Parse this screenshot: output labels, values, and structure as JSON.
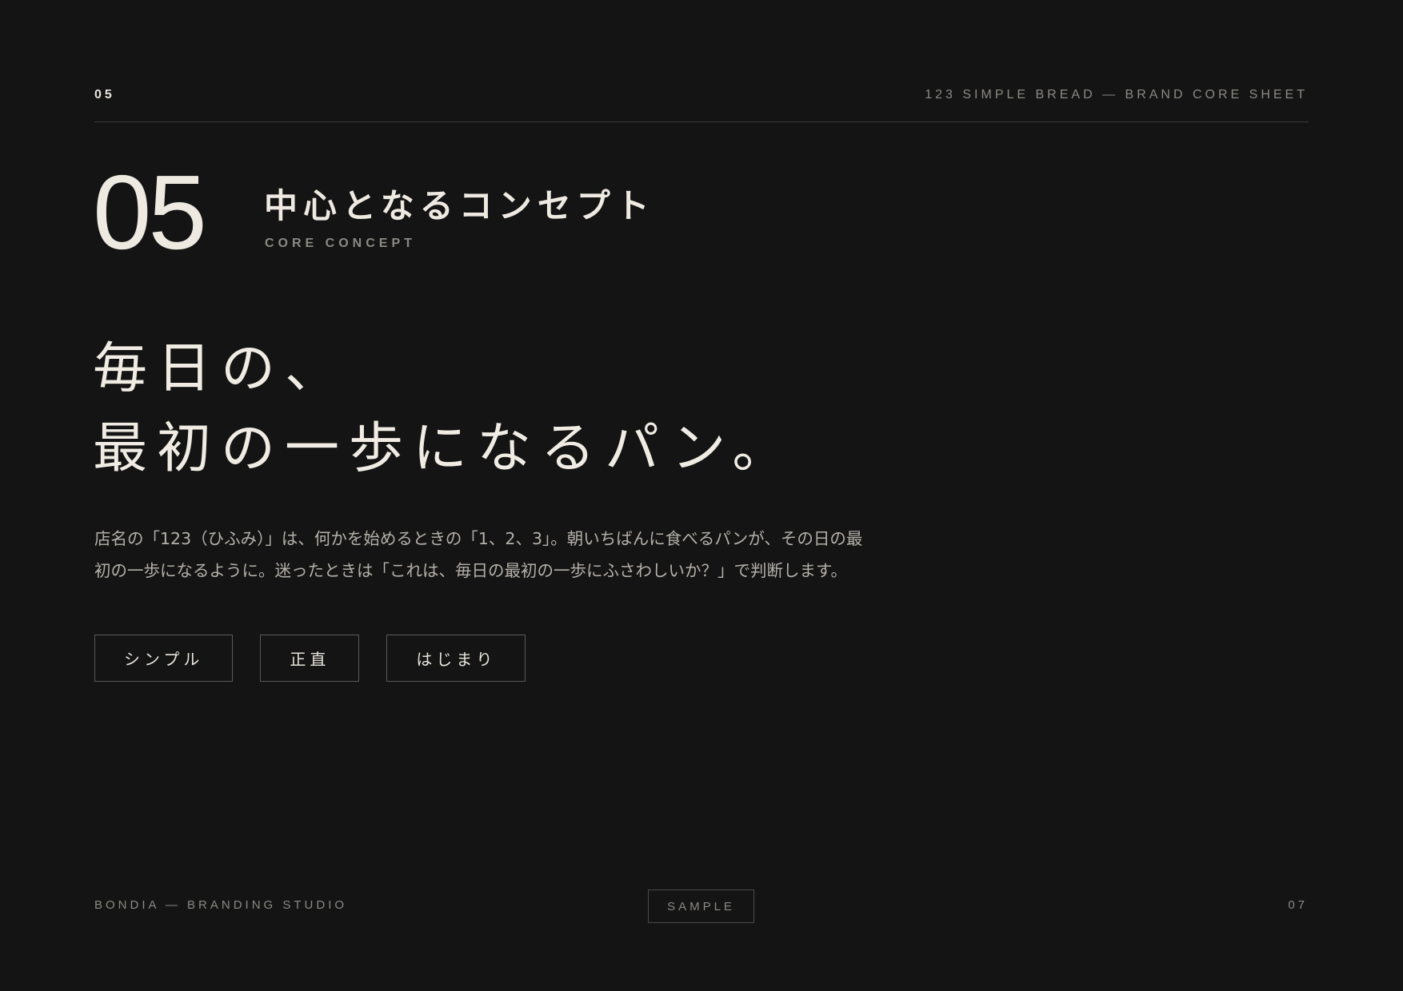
{
  "header": {
    "page_number": "05",
    "document_title": "123 SIMPLE BREAD — BRAND CORE SHEET"
  },
  "section": {
    "number": "05",
    "title": "中心となるコンセプト",
    "subtitle": "CORE CONCEPT"
  },
  "headline": {
    "lines": [
      "毎日の、",
      "最初の一歩になるパン。"
    ]
  },
  "body": {
    "lines": [
      "店名の「123（ひふみ）」は、何かを始めるときの「1、2、3」。朝いちばんに食べるパンが、その日の最",
      "初の一歩になるように。迷ったときは「これは、毎日の最初の一歩にふさわしいか？」で判断します。"
    ]
  },
  "keywords": [
    "シンプル",
    "正直",
    "はじまり"
  ],
  "footer": {
    "studio": "BONDIA — BRANDING STUDIO",
    "badge": "SAMPLE",
    "page_number": "07"
  }
}
